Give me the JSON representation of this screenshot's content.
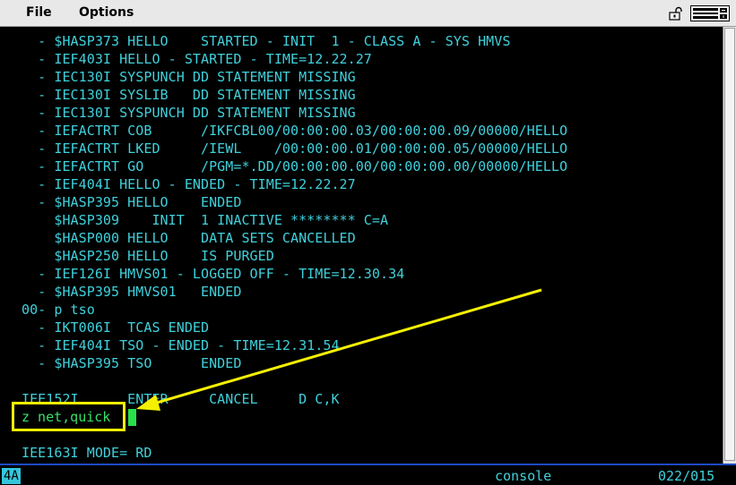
{
  "menubar": {
    "file_label": "File",
    "options_label": "Options",
    "icons": [
      "lock-icon",
      "keyboard-icon"
    ]
  },
  "terminal": {
    "lines": [
      "  - $HASP373 HELLO    STARTED - INIT  1 - CLASS A - SYS HMVS",
      "  - IEF403I HELLO - STARTED - TIME=12.22.27",
      "  - IEC130I SYSPUNCH DD STATEMENT MISSING",
      "  - IEC130I SYSLIB   DD STATEMENT MISSING",
      "  - IEC130I SYSPUNCH DD STATEMENT MISSING",
      "  - IEFACTRT COB      /IKFCBL00/00:00:00.03/00:00:00.09/00000/HELLO",
      "  - IEFACTRT LKED     /IEWL    /00:00:00.01/00:00:00.05/00000/HELLO",
      "  - IEFACTRT GO       /PGM=*.DD/00:00:00.00/00:00:00.00/00000/HELLO",
      "  - IEF404I HELLO - ENDED - TIME=12.22.27",
      "  - $HASP395 HELLO    ENDED",
      "    $HASP309    INIT  1 INACTIVE ******** C=A",
      "    $HASP000 HELLO    DATA SETS CANCELLED",
      "    $HASP250 HELLO    IS PURGED",
      "  - IEF126I HMVS01 - LOGGED OFF - TIME=12.30.34",
      "  - $HASP395 HMVS01   ENDED",
      "00- p tso",
      "  - IKT006I  TCAS ENDED",
      "  - IEF404I TSO - ENDED - TIME=12.31.54",
      "  - $HASP395 TSO      ENDED",
      "",
      "IEE152I      ENTER     CANCEL     D C,K",
      "",
      "IEE163I MODE= RD"
    ],
    "command_input": "z net,quick"
  },
  "annotation": {
    "highlight_color": "#f4f000"
  },
  "statusbar": {
    "indicator": "4A",
    "session": "console",
    "cursor_position": "022/015"
  },
  "colors": {
    "terminal_text": "#3fd1dc",
    "input_text": "#36e06a",
    "cursor": "#27e04a",
    "status_border": "#1f49c4"
  }
}
